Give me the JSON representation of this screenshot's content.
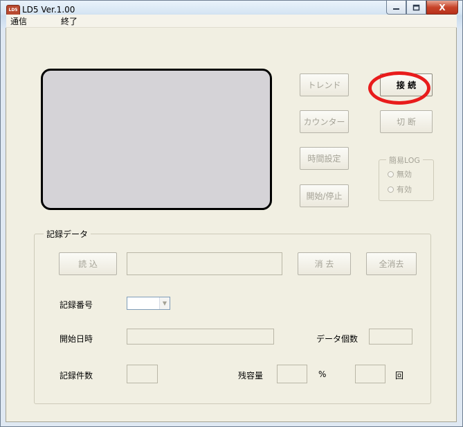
{
  "window": {
    "title": "LD5 Ver.1.00",
    "icon_text": "LD5",
    "icon_name": "app-icon",
    "close_glyph": "X"
  },
  "menu": [
    {
      "label": "通信"
    },
    {
      "label": "終了"
    }
  ],
  "buttons": {
    "trend": "トレンド",
    "counter": "カウンター",
    "time_setting": "時間設定",
    "start_stop": "開始/停止",
    "connect": "接 続",
    "disconnect": "切 断"
  },
  "simple_log": {
    "title": "簡易LOG",
    "options": [
      "無効",
      "有効"
    ]
  },
  "record": {
    "title": "記録データ",
    "read_button": "読 込",
    "delete_button": "消 去",
    "delete_all_button": "全消去",
    "record_number_label": "記録番号",
    "start_datetime_label": "開始日時",
    "data_count_label": "データ個数",
    "record_count_label": "記録件数",
    "remaining_label": "残容量",
    "percent_unit": "%",
    "times_unit": "回"
  },
  "colors": {
    "annotation": "#e81c1c",
    "disabled_text": "#a4a296",
    "client_bg": "#f1efe2"
  }
}
